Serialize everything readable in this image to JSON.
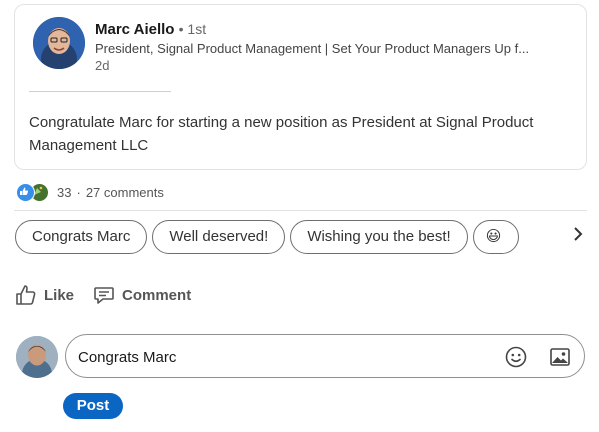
{
  "post": {
    "author_name": "Marc Aiello",
    "degree": "• 1st",
    "headline": "President, Signal Product Management | Set Your Product Managers Up f...",
    "time": "2d",
    "text": "Congratulate Marc for starting a new position as President at Signal Product Management LLC"
  },
  "social": {
    "reactions_count": "33",
    "separator": "·",
    "comments": "27 comments",
    "reaction_icons": [
      "like-reaction-icon",
      "celebrate-reaction-icon"
    ]
  },
  "suggestions": {
    "chips": [
      "Congrats Marc",
      "Well deserved!",
      "Wishing you the best!"
    ],
    "emoji_chip": "😃",
    "next_icon": "chevron-right-icon"
  },
  "actions": {
    "like_label": "Like",
    "comment_label": "Comment"
  },
  "comment": {
    "input_value": "Congrats Marc",
    "post_label": "Post"
  },
  "colors": {
    "accent": "#0a66c2",
    "like_blue": "#378fe9",
    "celebrate_green": "#44712e"
  }
}
